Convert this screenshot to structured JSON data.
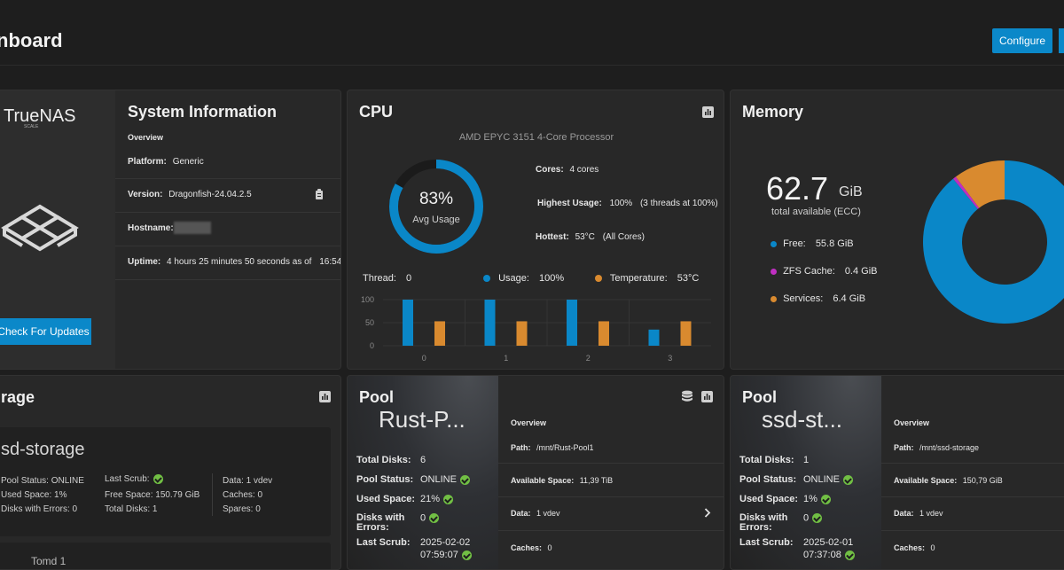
{
  "header": {
    "title": "nboard",
    "configure_label": "Configure"
  },
  "sysinfo": {
    "title": "System Information",
    "logo_text": "TrueNAS",
    "logo_sub": "SCALE",
    "overview_label": "Overview",
    "platform_label": "Platform:",
    "platform_value": "Generic",
    "version_label": "Version:",
    "version_value": "Dragonfish-24.04.2.5",
    "hostname_label": "Hostname:",
    "uptime_label": "Uptime:",
    "uptime_value": "4 hours 25 minutes 50 seconds as of",
    "uptime_time": "16:54",
    "check_updates_label": "Check For Updates"
  },
  "cpu": {
    "title": "CPU",
    "model": "AMD EPYC 3151 4-Core Processor",
    "avg_percent": "83%",
    "avg_label": "Avg Usage",
    "avg_fraction": 0.83,
    "cores_label": "Cores:",
    "cores_value": "4 cores",
    "highest_label": "Highest Usage:",
    "highest_value": "100%",
    "highest_detail": "(3 threads at 100%)",
    "hottest_label": "Hottest:",
    "hottest_value": "53°C",
    "hottest_detail": "(All Cores)",
    "thread_label": "Thread:",
    "thread_value": "0",
    "usage_label": "Usage:",
    "usage_value": "100%",
    "temp_label": "Temperature:",
    "temp_value": "53°C",
    "colors": {
      "usage": "#0a87c8",
      "temperature": "#d98a2f"
    }
  },
  "chart_data": {
    "type": "bar",
    "categories": [
      "0",
      "1",
      "2",
      "3"
    ],
    "y_ticks": [
      "100",
      "50",
      "0"
    ],
    "ylim": [
      0,
      100
    ],
    "series": [
      {
        "name": "Usage",
        "values": [
          100,
          100,
          100,
          35
        ],
        "color": "#0a87c8"
      },
      {
        "name": "Temperature",
        "values": [
          53,
          53,
          53,
          53
        ],
        "color": "#d98a2f"
      }
    ]
  },
  "memory": {
    "title": "Memory",
    "total_value": "62.7",
    "total_unit": "GiB",
    "total_label": "total available (ECC)",
    "free_label": "Free:",
    "free_value": "55.8 GiB",
    "zfs_label": "ZFS Cache:",
    "zfs_value": "0.4 GiB",
    "services_label": "Services:",
    "services_value": "6.4 GiB",
    "colors": {
      "free": "#0a87c8",
      "zfs": "#c02fc2",
      "services": "#d98a2f"
    }
  },
  "storage": {
    "title": "rage",
    "pool_name": "sd-storage",
    "pool_status": "Pool Status:  ONLINE",
    "used_space": "Used Space:  1%",
    "disks_errors": "Disks with Errors:  0",
    "last_scrub": "Last Scrub:",
    "free_space": "Free Space:  150.79 GiB",
    "total_disks": "Total Disks:  1",
    "data": "Data:  1 vdev",
    "caches": "Caches:  0",
    "spares": "Spares:  0",
    "bottom_text": "Tomd 1"
  },
  "pool_rust": {
    "title": "Pool",
    "name": "Rust-P...",
    "total_disks_label": "Total Disks:",
    "total_disks_value": "6",
    "status_label": "Pool Status:",
    "status_value": "ONLINE",
    "used_label": "Used Space:",
    "used_value": "21%",
    "errors_label": "Disks with",
    "errors_label2": "Errors:",
    "errors_value": "0",
    "scrub_label": "Last Scrub:",
    "scrub_date": "2025-02-02",
    "scrub_time": "07:59:07",
    "overview_label": "Overview",
    "path_label": "Path:",
    "path_value": "/mnt/Rust-Pool1",
    "avail_label": "Available Space:",
    "avail_value": "11,39  TiB",
    "data_label": "Data:",
    "data_value": "1 vdev",
    "caches_label": "Caches:",
    "caches_value": "0"
  },
  "pool_ssd": {
    "title": "Pool",
    "name": "ssd-st...",
    "total_disks_label": "Total Disks:",
    "total_disks_value": "1",
    "status_label": "Pool Status:",
    "status_value": "ONLINE",
    "used_label": "Used Space:",
    "used_value": "1%",
    "errors_label": "Disks with",
    "errors_label2": "Errors:",
    "errors_value": "0",
    "scrub_label": "Last Scrub:",
    "scrub_date": "2025-02-01",
    "scrub_time": "07:37:08",
    "overview_label": "Overview",
    "path_label": "Path:",
    "path_value": "/mnt/ssd-storage",
    "avail_label": "Available Space:",
    "avail_value": "150,79  GiB",
    "data_label": "Data:",
    "data_value": "1 vdev",
    "caches_label": "Caches:",
    "caches_value": "0"
  }
}
